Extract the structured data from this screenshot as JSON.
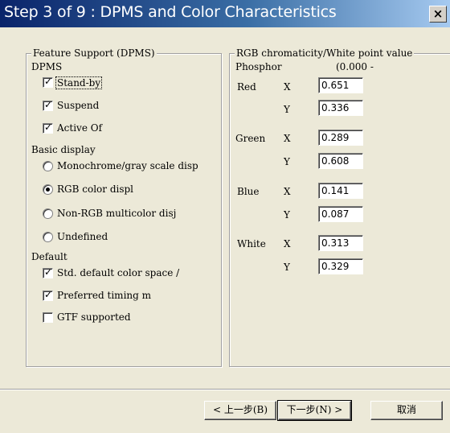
{
  "window": {
    "title": "Step 3 of 9 : DPMS and Color Characteristics",
    "close_glyph": "×"
  },
  "feature_group": {
    "title": "Feature Support (DPMS)",
    "dpms_label": "DPMS",
    "dpms_items": [
      {
        "label": "Stand-by",
        "checked": true
      },
      {
        "label": "Suspend",
        "checked": true
      },
      {
        "label": "Active Of",
        "checked": true
      }
    ],
    "basic_display_label": "Basic display",
    "display_options": [
      {
        "label": "Monochrome/gray scale disp",
        "selected": false
      },
      {
        "label": "RGB color displ",
        "selected": true
      },
      {
        "label": "Non-RGB multicolor disj",
        "selected": false
      },
      {
        "label": "Undefined",
        "selected": false
      }
    ],
    "default_label": "Default",
    "default_items": [
      {
        "label": "Std. default color space /",
        "checked": true
      },
      {
        "label": "Preferred timing m",
        "checked": true
      },
      {
        "label": "GTF supported",
        "checked": false
      }
    ]
  },
  "chroma_group": {
    "title": "RGB chromaticity/White point value",
    "phosphor_label": "Phosphor",
    "range_label": "(0.000 -",
    "x_label": "X",
    "y_label": "Y",
    "rows": [
      {
        "name": "Red",
        "x": "0.651",
        "y": "0.336"
      },
      {
        "name": "Green",
        "x": "0.289",
        "y": "0.608"
      },
      {
        "name": "Blue",
        "x": "0.141",
        "y": "0.087"
      },
      {
        "name": "White",
        "x": "0.313",
        "y": "0.329"
      }
    ]
  },
  "buttons": {
    "back": "< 上一步(B)",
    "next": "下一步(N) >",
    "cancel": "取消"
  },
  "colors": {
    "titlebar_start": "#0a246a",
    "titlebar_end": "#a6caf0",
    "dialog_bg": "#ece9d8"
  }
}
